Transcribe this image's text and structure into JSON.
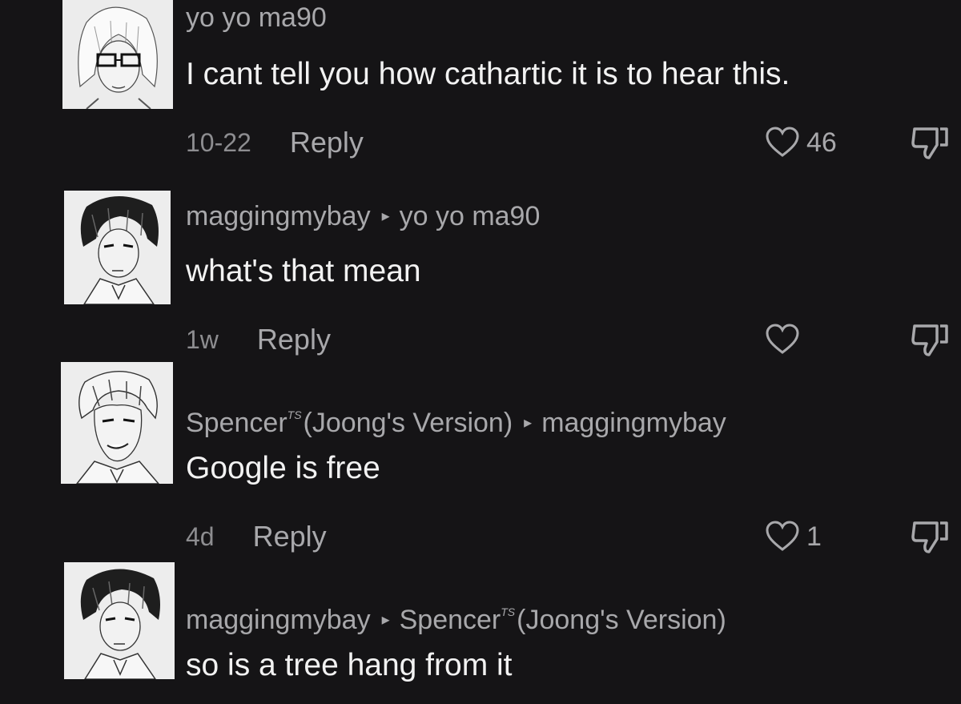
{
  "comments": [
    {
      "username": "yo yo ma90",
      "text": "I cant tell you how cathartic it is to hear this.",
      "time": "10-22",
      "reply_label": "Reply",
      "likes": "46"
    },
    {
      "username": "maggingmybay",
      "reply_to": "yo yo ma90",
      "text": "what's that mean",
      "time": "1w",
      "reply_label": "Reply",
      "likes": ""
    },
    {
      "username": "Spencer",
      "username_sup": "TS",
      "username_suffix": "(Joong's Version)",
      "reply_to": "maggingmybay",
      "text": "Google is free",
      "time": "4d",
      "reply_label": "Reply",
      "likes": "1"
    },
    {
      "username": "maggingmybay",
      "reply_to_name": "Spencer",
      "reply_to_sup": "TS",
      "reply_to_suffix": "(Joong's Version)",
      "text": "so is a tree hang from it"
    }
  ],
  "icons": {
    "arrow": "▸",
    "like": "heart-outline-icon",
    "dislike": "thumbs-down-outline-icon"
  },
  "colors": {
    "background": "#151416",
    "username": "#a8a8ab",
    "text": "#f2f2f2"
  }
}
